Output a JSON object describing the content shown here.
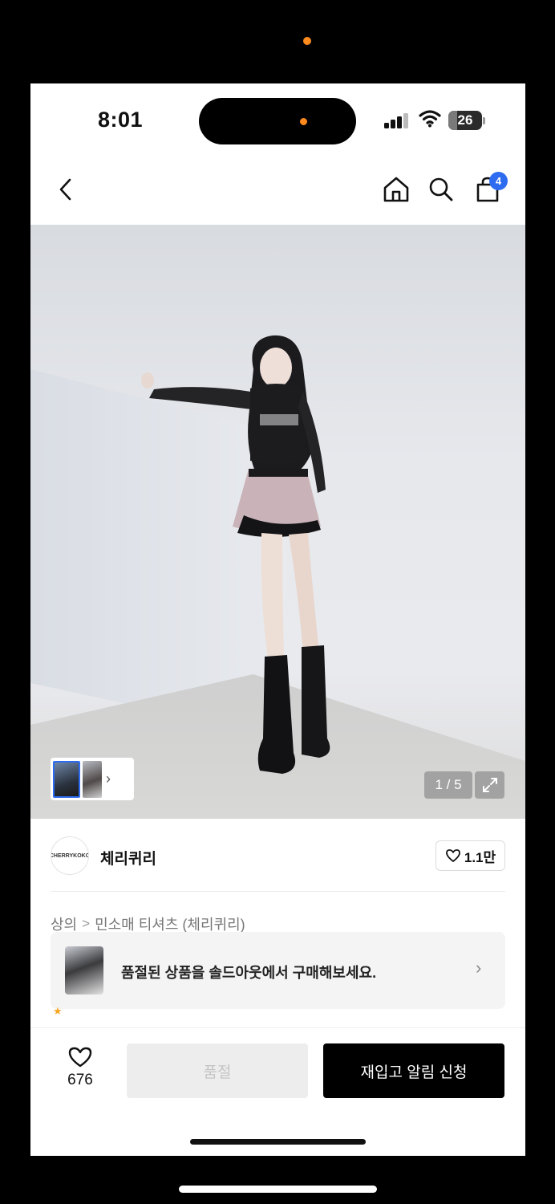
{
  "status_bar": {
    "time": "8:01",
    "battery": "26",
    "battery_fraction": 0.26
  },
  "nav": {
    "cart_count": "4"
  },
  "gallery": {
    "page_indicator": "1 / 5"
  },
  "store": {
    "logo_text": "CHERRYKOKO",
    "name": "체리퀴리",
    "likes": "1.1만"
  },
  "breadcrumb": {
    "category": "상의",
    "separator": ">",
    "product": "민소매 티셔츠 (체리퀴리)"
  },
  "soldout_banner": {
    "text": "품절된 상품을 솔드아웃에서 구매해보세요."
  },
  "bottom_bar": {
    "wish_count": "676",
    "soldout_label": "품절",
    "restock_label": "재입고 알림 신청"
  },
  "colors": {
    "accent_badge": "#2d6cf0",
    "primary_button": "#000000",
    "disabled_button": "#ededed",
    "status_dot": "#ff8a1e"
  },
  "icons": {
    "back": "chevron-left-icon",
    "home": "home-icon",
    "search": "search-icon",
    "cart": "shopping-bag-icon",
    "expand": "expand-icon",
    "heart": "heart-icon",
    "chevron": "chevron-right-icon"
  }
}
